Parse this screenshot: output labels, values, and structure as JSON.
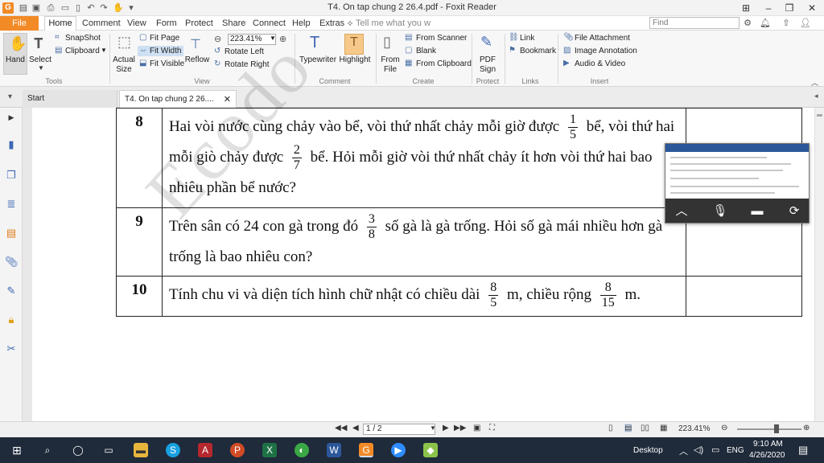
{
  "window": {
    "title": "T4. On tap chung 2 26.4.pdf - Foxit Reader"
  },
  "menu": {
    "file": "File",
    "home": "Home",
    "items": [
      "Comment",
      "View",
      "Form",
      "Protect",
      "Share",
      "Connect",
      "Help",
      "Extras"
    ],
    "tell_me": "Tell me what you w",
    "find_placeholder": "Find"
  },
  "ribbon": {
    "tools": {
      "hand": "Hand",
      "select": "Select",
      "snapshot": "SnapShot",
      "clipboard": "Clipboard",
      "group": "Tools"
    },
    "view": {
      "actual_size": "Actual Size",
      "fit_page": "Fit Page",
      "fit_width": "Fit Width",
      "fit_visible": "Fit Visible",
      "reflow": "Reflow",
      "zoom": "223.41%",
      "rotate_left": "Rotate Left",
      "rotate_right": "Rotate Right",
      "group": "View"
    },
    "comment": {
      "typewriter": "Typewriter",
      "highlight": "Highlight",
      "group": "Comment"
    },
    "create": {
      "from_file": "From File",
      "from_scanner": "From Scanner",
      "blank": "Blank",
      "from_clipboard": "From Clipboard",
      "group": "Create"
    },
    "protect": {
      "pdf_sign": "PDF Sign",
      "group": "Protect"
    },
    "links": {
      "link": "Link",
      "bookmark": "Bookmark",
      "group": "Links"
    },
    "insert": {
      "file_attachment": "File Attachment",
      "image_annotation": "Image Annotation",
      "audio_video": "Audio & Video",
      "group": "Insert"
    }
  },
  "tabs": {
    "start": "Start",
    "doc": "T4. On tap chung 2 26...."
  },
  "document": {
    "watermark": "Ecodo",
    "rows": [
      {
        "num": "8",
        "a": "Hai vòi nước cùng chảy vào bể, vòi thứ nhất chảy mỗi giờ được",
        "f1n": "1",
        "f1d": "5",
        "b": "bể, vòi thứ hai mỗi giò chảy được",
        "f2n": "2",
        "f2d": "7",
        "c": "bể. Hỏi mỗi giờ vòi thứ nhất chảy ít hơn vòi thứ hai bao nhiêu phần bể nước?"
      },
      {
        "num": "9",
        "a": "Trên sân có 24 con gà trong đó",
        "f1n": "3",
        "f1d": "8",
        "b": "số gà là gà trống. Hỏi số gà mái nhiều hơn gà trống là bao nhiêu con?"
      },
      {
        "num": "10",
        "a": "Tính chu vi và diện tích hình chữ nhật có chiều dài",
        "f1n": "8",
        "f1d": "5",
        "b": "m, chiều rộng",
        "f2n": "8",
        "f2d": "15",
        "c": "m."
      }
    ]
  },
  "statusbar": {
    "page": "1 / 2",
    "zoom": "223.41%",
    "zoom_level_percent": 60
  },
  "taskbar": {
    "desktop": "Desktop",
    "lang": "ENG",
    "time": "9:10 AM",
    "date": "4/26/2020"
  },
  "colors": {
    "accent": "#f28a26",
    "taskbar": "#1f2a3a",
    "ribbon_icon": "#4a6fa5"
  }
}
